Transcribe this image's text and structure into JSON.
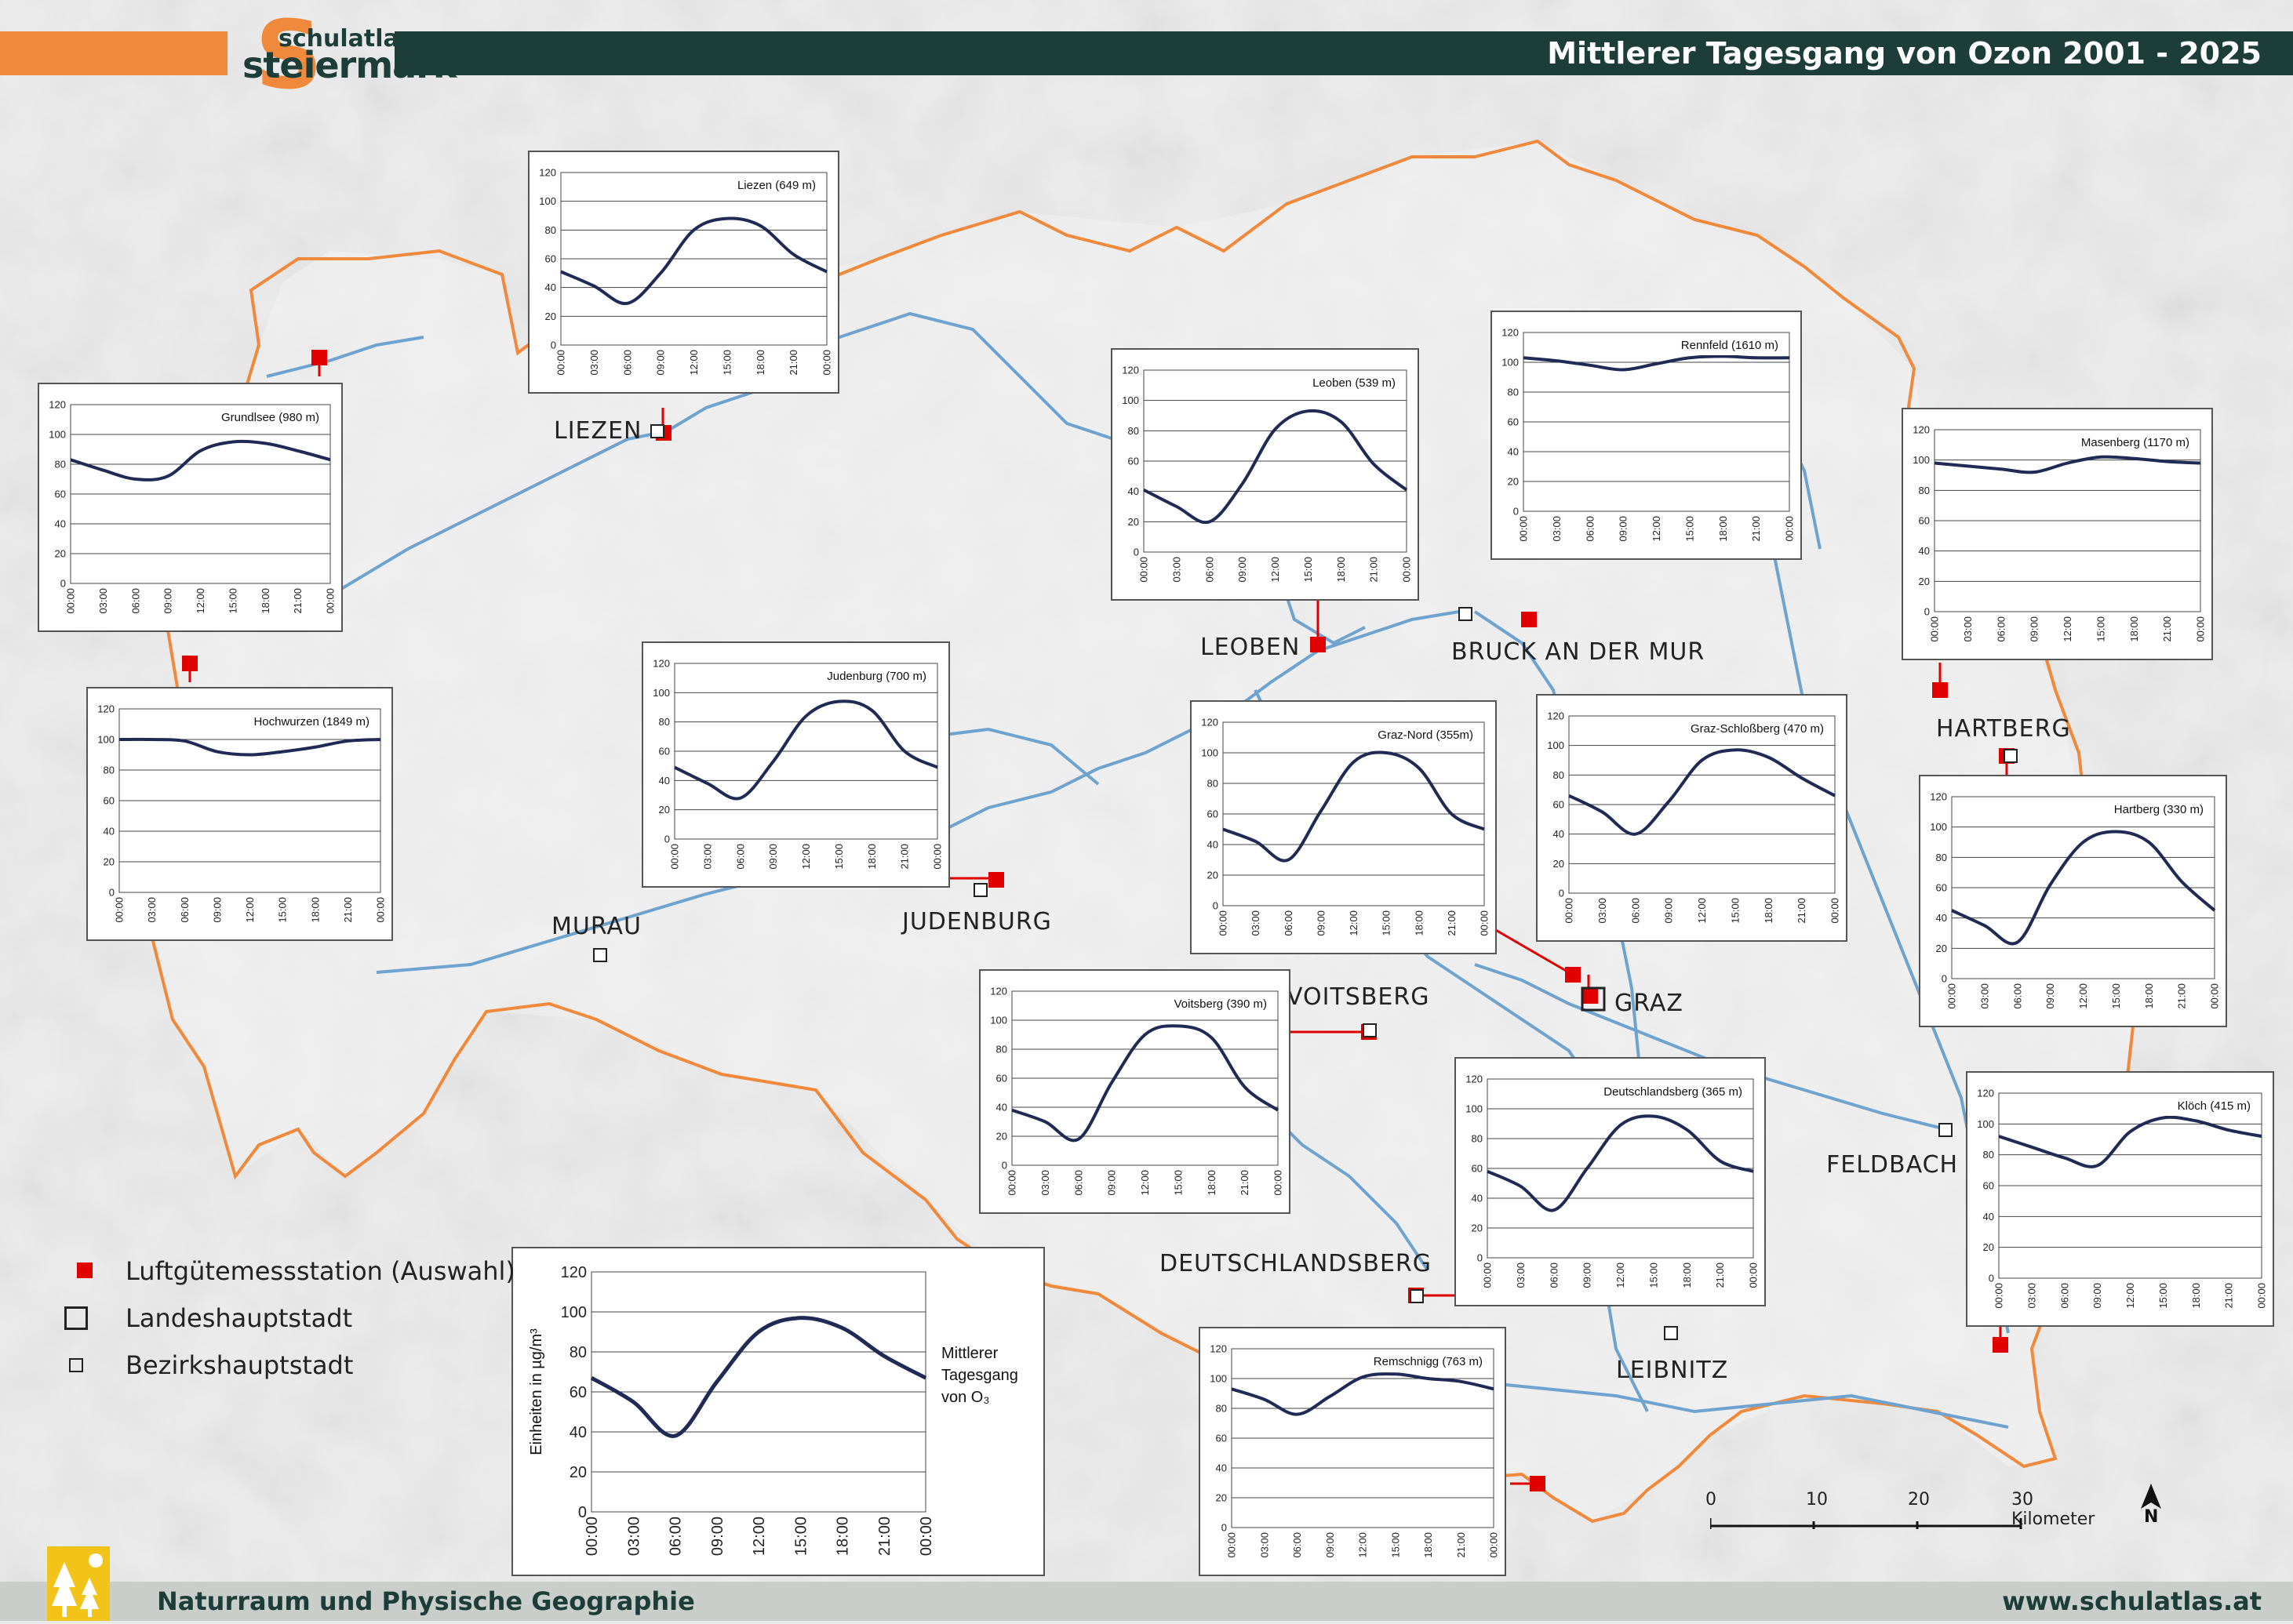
{
  "header": {
    "title": "Mittlerer Tagesgang von Ozon 2001 - 2025",
    "logo_line1": "schulatlas",
    "logo_line2": "steiermark",
    "logo_letter": "S"
  },
  "footer": {
    "left": "Naturraum und Physische Geographie",
    "right": "www.schulatlas.at"
  },
  "colors": {
    "orange": "#f0893b",
    "dark": "#1d3e38",
    "curve": "#1f2a55",
    "river": "#6fa3cf",
    "border": "#f0893b",
    "station": "#e00000"
  },
  "legend": {
    "station": "Luftgütemessstation (Auswahl)",
    "capital": "Landeshauptstadt",
    "district": "Bezirkshauptstadt"
  },
  "scale": {
    "ticks": [
      "0",
      "10",
      "20",
      "30 Kilometer"
    ],
    "north": "N"
  },
  "cities": {
    "liezen": "LIEZEN",
    "leoben": "LEOBEN",
    "bruck": "BRUCK AN DER MUR",
    "hartberg": "HARTBERG",
    "murau": "MURAU",
    "judenburg": "JUDENBURG",
    "voitsberg": "VOITSBERG",
    "graz": "GRAZ",
    "feldbach": "FELDBACH",
    "deutschlandsberg": "DEUTSCHLANDSBERG",
    "leibnitz": "LEIBNITZ"
  },
  "chart_data": [
    {
      "type": "line",
      "title": "Liezen (649 m)",
      "x": [
        "00:00",
        "03:00",
        "06:00",
        "09:00",
        "12:00",
        "15:00",
        "18:00",
        "21:00",
        "00:00"
      ],
      "ylim": [
        0,
        120
      ],
      "yticks": [
        0,
        20,
        40,
        60,
        80,
        100,
        120
      ],
      "values": [
        51,
        41,
        29,
        50,
        80,
        88,
        83,
        63,
        51
      ]
    },
    {
      "type": "line",
      "title": "Grundlsee (980 m)",
      "x": [
        "00:00",
        "03:00",
        "06:00",
        "09:00",
        "12:00",
        "15:00",
        "18:00",
        "21:00",
        "00:00"
      ],
      "ylim": [
        0,
        120
      ],
      "yticks": [
        0,
        20,
        40,
        60,
        80,
        100,
        120
      ],
      "values": [
        83,
        76,
        70,
        72,
        89,
        95,
        94,
        89,
        83
      ]
    },
    {
      "type": "line",
      "title": "Hochwurzen (1849 m)",
      "x": [
        "00:00",
        "03:00",
        "06:00",
        "09:00",
        "12:00",
        "15:00",
        "18:00",
        "21:00",
        "00:00"
      ],
      "ylim": [
        0,
        120
      ],
      "yticks": [
        0,
        20,
        40,
        60,
        80,
        100,
        120
      ],
      "values": [
        100,
        100,
        99,
        92,
        90,
        92,
        95,
        99,
        100
      ]
    },
    {
      "type": "line",
      "title": "Judenburg (700 m)",
      "x": [
        "00:00",
        "03:00",
        "06:00",
        "09:00",
        "12:00",
        "15:00",
        "18:00",
        "21:00",
        "00:00"
      ],
      "ylim": [
        0,
        120
      ],
      "yticks": [
        0,
        20,
        40,
        60,
        80,
        100,
        120
      ],
      "values": [
        49,
        38,
        28,
        53,
        84,
        94,
        88,
        60,
        49
      ]
    },
    {
      "type": "line",
      "title": "Leoben (539 m)",
      "x": [
        "00:00",
        "03:00",
        "06:00",
        "09:00",
        "12:00",
        "15:00",
        "18:00",
        "21:00",
        "00:00"
      ],
      "ylim": [
        0,
        120
      ],
      "yticks": [
        0,
        20,
        40,
        60,
        80,
        100,
        120
      ],
      "values": [
        41,
        30,
        20,
        45,
        81,
        93,
        86,
        58,
        41
      ]
    },
    {
      "type": "line",
      "title": "Rennfeld (1610 m)",
      "x": [
        "00:00",
        "03:00",
        "06:00",
        "09:00",
        "12:00",
        "15:00",
        "18:00",
        "21:00",
        "00:00"
      ],
      "ylim": [
        0,
        120
      ],
      "yticks": [
        0,
        20,
        40,
        60,
        80,
        100,
        120
      ],
      "values": [
        103,
        101,
        98,
        95,
        99,
        103,
        104,
        103,
        103
      ]
    },
    {
      "type": "line",
      "title": "Masenberg (1170 m)",
      "x": [
        "00:00",
        "03:00",
        "06:00",
        "09:00",
        "12:00",
        "15:00",
        "18:00",
        "21:00",
        "00:00"
      ],
      "ylim": [
        0,
        120
      ],
      "yticks": [
        0,
        20,
        40,
        60,
        80,
        100,
        120
      ],
      "values": [
        98,
        96,
        94,
        92,
        98,
        102,
        101,
        99,
        98
      ]
    },
    {
      "type": "line",
      "title": "Graz-Nord (355m)",
      "x": [
        "00:00",
        "03:00",
        "06:00",
        "09:00",
        "12:00",
        "15:00",
        "18:00",
        "21:00",
        "00:00"
      ],
      "ylim": [
        0,
        120
      ],
      "yticks": [
        0,
        20,
        40,
        60,
        80,
        100,
        120
      ],
      "values": [
        50,
        42,
        30,
        62,
        94,
        100,
        90,
        60,
        50
      ]
    },
    {
      "type": "line",
      "title": "Graz-Schloßberg (470 m)",
      "x": [
        "00:00",
        "03:00",
        "06:00",
        "09:00",
        "12:00",
        "15:00",
        "18:00",
        "21:00",
        "00:00"
      ],
      "ylim": [
        0,
        120
      ],
      "yticks": [
        0,
        20,
        40,
        60,
        80,
        100,
        120
      ],
      "values": [
        66,
        55,
        40,
        62,
        90,
        97,
        92,
        78,
        66
      ]
    },
    {
      "type": "line",
      "title": "Hartberg (330 m)",
      "x": [
        "00:00",
        "03:00",
        "06:00",
        "09:00",
        "12:00",
        "15:00",
        "18:00",
        "21:00",
        "00:00"
      ],
      "ylim": [
        0,
        120
      ],
      "yticks": [
        0,
        20,
        40,
        60,
        80,
        100,
        120
      ],
      "values": [
        45,
        35,
        24,
        62,
        90,
        97,
        90,
        64,
        45
      ]
    },
    {
      "type": "line",
      "title": "Voitsberg (390 m)",
      "x": [
        "00:00",
        "03:00",
        "06:00",
        "09:00",
        "12:00",
        "15:00",
        "18:00",
        "21:00",
        "00:00"
      ],
      "ylim": [
        0,
        120
      ],
      "yticks": [
        0,
        20,
        40,
        60,
        80,
        100,
        120
      ],
      "values": [
        38,
        30,
        18,
        57,
        90,
        96,
        88,
        54,
        38
      ]
    },
    {
      "type": "line",
      "title": "Deutschlandsberg (365 m)",
      "x": [
        "00:00",
        "03:00",
        "06:00",
        "09:00",
        "12:00",
        "15:00",
        "18:00",
        "21:00",
        "00:00"
      ],
      "ylim": [
        0,
        120
      ],
      "yticks": [
        0,
        20,
        40,
        60,
        80,
        100,
        120
      ],
      "values": [
        58,
        48,
        32,
        60,
        89,
        95,
        86,
        65,
        58
      ]
    },
    {
      "type": "line",
      "title": "Klöch (415 m)",
      "x": [
        "00:00",
        "03:00",
        "06:00",
        "09:00",
        "12:00",
        "15:00",
        "18:00",
        "21:00",
        "00:00"
      ],
      "ylim": [
        0,
        120
      ],
      "yticks": [
        0,
        20,
        40,
        60,
        80,
        100,
        120
      ],
      "values": [
        92,
        85,
        78,
        73,
        95,
        104,
        102,
        96,
        92
      ]
    },
    {
      "type": "line",
      "title": "Remschnigg (763 m)",
      "x": [
        "00:00",
        "03:00",
        "06:00",
        "09:00",
        "12:00",
        "15:00",
        "18:00",
        "21:00",
        "00:00"
      ],
      "ylim": [
        0,
        120
      ],
      "yticks": [
        0,
        20,
        40,
        60,
        80,
        100,
        120
      ],
      "values": [
        93,
        86,
        76,
        88,
        101,
        103,
        100,
        98,
        93
      ]
    },
    {
      "type": "line",
      "title": "",
      "ylabel": "Einheiten in µg/m³",
      "annotation": [
        "Mittlerer",
        "Tagesgang",
        "von O₃"
      ],
      "x": [
        "00:00",
        "03:00",
        "06:00",
        "09:00",
        "12:00",
        "15:00",
        "18:00",
        "21:00",
        "00:00"
      ],
      "ylim": [
        0,
        120
      ],
      "yticks": [
        0,
        20,
        40,
        60,
        80,
        100,
        120
      ],
      "values": [
        67,
        55,
        38,
        65,
        90,
        97,
        92,
        78,
        67
      ]
    }
  ]
}
